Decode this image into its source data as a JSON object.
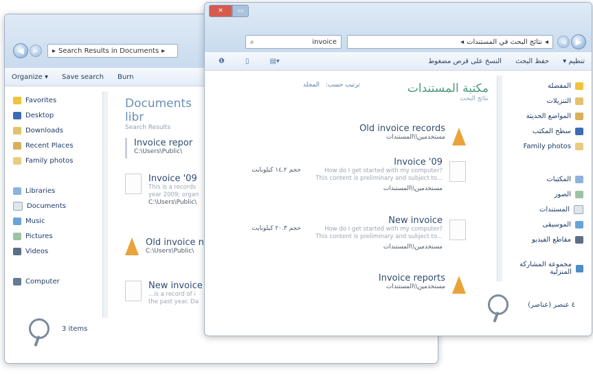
{
  "left_window": {
    "address": "Search Results in Documents",
    "toolbar": [
      "Organize ▾",
      "Save search",
      "Burn"
    ],
    "nav": {
      "favorites_header": "Favorites",
      "favorites": [
        "Desktop",
        "Downloads",
        "Recent Places",
        "Family photos"
      ],
      "libraries_header": "Libraries",
      "libraries": [
        "Documents",
        "Music",
        "Pictures",
        "Videos"
      ],
      "computer": "Computer"
    },
    "content": {
      "title": "Documents libr",
      "subtitle": "Search Results",
      "items": [
        {
          "name": "Invoice repor",
          "path": "C:\\Users\\Public\\",
          "snippet": ""
        },
        {
          "name": "Invoice '09",
          "path": "C:\\Users\\Public\\",
          "snippet": "This is a records\nyear 2009; organ"
        },
        {
          "name": "Old invoice n",
          "path": "C:\\Users\\Public\\",
          "snippet": ""
        },
        {
          "name": "New invoice",
          "path": "",
          "snippet": "...is a record of i\nthe past year. Da"
        }
      ]
    },
    "details": "3 items"
  },
  "right_window": {
    "address": "نتائج البحث في المستندات",
    "search_text": "invoice",
    "toolbar": [
      "تنظيم ▾",
      "حفظ البحث",
      "النسخ على قرص مضغوط"
    ],
    "nav": {
      "favorites_header": "المفضلة",
      "favorites": [
        "التنزيلات",
        "المواضع الحديثة",
        "سطح المكتب",
        "Family photos"
      ],
      "libraries_header": "المكتبات",
      "libraries": [
        "الصور",
        "المستندات",
        "الموسيقى",
        "مقاطع الفيديو"
      ],
      "homegroup": "مجموعة المشاركة المنزلية"
    },
    "content": {
      "title": "مكتبة المستندات",
      "subtitle": "نتائج البحث",
      "arrange": "ترتيب حسب:",
      "folder": "المجلد",
      "items": [
        {
          "name": "Old invoice records",
          "path": "مستخدمين\\\\المستندات",
          "snippet": "",
          "size": ""
        },
        {
          "name": "Invoice '09",
          "path": "مستخدمين\\\\المستندات",
          "snippet": "How do I get started with my computer?\nThis content is preliminary and subject to...",
          "size": "حجم ١٤.٢ كيلوبايت"
        },
        {
          "name": "New invoice",
          "path": "مستخدمين\\\\المستندات",
          "snippet": "How do I get started with my computer?\nThis content is preliminary and subject to...",
          "size": "حجم ٢٠.٣ كيلوبايت"
        },
        {
          "name": "Invoice reports",
          "path": "مستخدمين\\\\المستندات",
          "snippet": "",
          "size": ""
        }
      ]
    },
    "details": "٤ عنصر (عناصر)"
  }
}
